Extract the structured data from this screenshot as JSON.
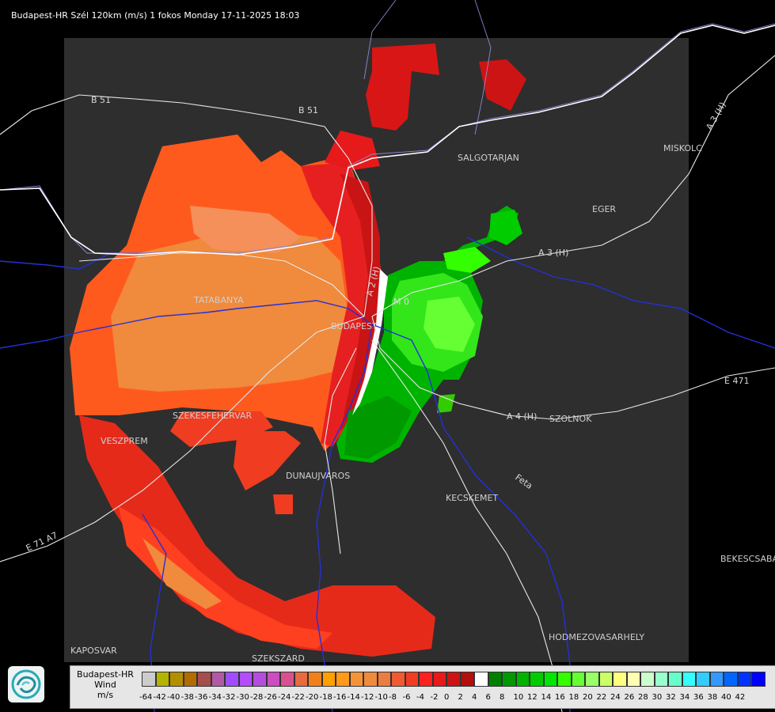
{
  "title": "Budapest-HR Szél 120km (m/s) 1 fokos Monday 17-11-2025 18:03",
  "cities": [
    {
      "name": "SALGOTARJAN"
    },
    {
      "name": "MISKOLC"
    },
    {
      "name": "EGER"
    },
    {
      "name": "TATABANYA"
    },
    {
      "name": "BUDAPEST"
    },
    {
      "name": "SZEKESFEHERVAR"
    },
    {
      "name": "VESZPREM"
    },
    {
      "name": "DUNAUJVAROS"
    },
    {
      "name": "KECSKEMET"
    },
    {
      "name": "SZOLNOK"
    },
    {
      "name": "BEKESCSABA"
    },
    {
      "name": "HODMEZOVASARHELY"
    },
    {
      "name": "KAPOSVAR"
    },
    {
      "name": "SZEKSZARD"
    }
  ],
  "roads": [
    {
      "name": "B 51"
    },
    {
      "name": "B 51"
    },
    {
      "name": "A 3 (H)"
    },
    {
      "name": "A 3 (H)"
    },
    {
      "name": "A 4 (H)"
    },
    {
      "name": "E 471"
    },
    {
      "name": "E 71 A7"
    },
    {
      "name": "M 0"
    },
    {
      "name": "A 2 (H)"
    },
    {
      "name": "Feta"
    }
  ],
  "legend": {
    "name": "Budapest-HR",
    "quantity": "Wind",
    "unit": "m/s",
    "colors": [
      "#cccccc",
      "#b3b300",
      "#b38f00",
      "#b36b00",
      "#a64d4d",
      "#b05aa6",
      "#a04dff",
      "#b34dff",
      "#b34ddf",
      "#cc4dc0",
      "#d9508f",
      "#e86a3e",
      "#f2801a",
      "#ffa000",
      "#ff9a1a",
      "#f59436",
      "#f08a3c",
      "#eb7d40",
      "#f05a30",
      "#f03c20",
      "#ff2020",
      "#e61a1a",
      "#cc1414",
      "#b30e0e",
      "#ffffff",
      "#008000",
      "#009900",
      "#00b300",
      "#00cc00",
      "#00e600",
      "#33ff00",
      "#66ff33",
      "#99ff66",
      "#ccff66",
      "#ffff80",
      "#ffffb3",
      "#ccffcc",
      "#99ffcc",
      "#66ffcc",
      "#33ffff",
      "#33ccff",
      "#3399ff",
      "#0066ff",
      "#0033ff",
      "#0000ff"
    ],
    "ticks": [
      "-64",
      "-42",
      "-40",
      "-38",
      "-36",
      "-34",
      "-32",
      "-30",
      "-28",
      "-26",
      "-24",
      "-22",
      "-20",
      "-18",
      "-16",
      "-14",
      "-12",
      "-10",
      "-8",
      "-6",
      "-4",
      "-2",
      "0",
      "2",
      "4",
      "6",
      "8",
      "10",
      "12",
      "14",
      "16",
      "18",
      "20",
      "22",
      "24",
      "26",
      "28",
      "30",
      "32",
      "34",
      "36",
      "38",
      "40",
      "42"
    ]
  },
  "logo": {
    "icon": "swirl-logo-icon"
  }
}
